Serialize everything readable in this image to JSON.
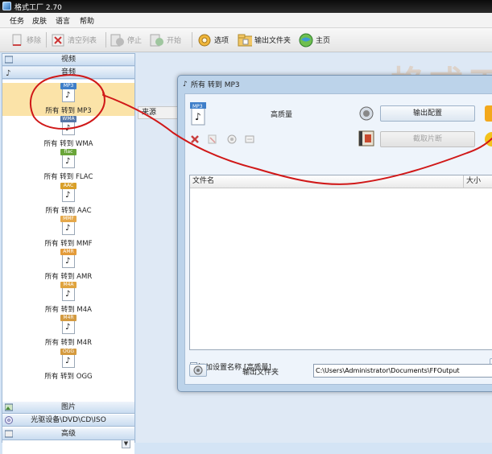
{
  "app": {
    "title": "格式工厂 2.70"
  },
  "menu": [
    "任务",
    "皮肤",
    "语言",
    "帮助"
  ],
  "toolbar": {
    "remove": "移除",
    "clear_list": "清空列表",
    "stop": "停止",
    "start": "开始",
    "options": "选项",
    "output_folder": "输出文件夹",
    "home": "主页"
  },
  "sidebar": {
    "categories_top": [
      {
        "label": "视频",
        "icon": "video-icon"
      },
      {
        "label": "音频",
        "icon": "audio-icon"
      }
    ],
    "conversions": [
      {
        "label": "所有 转到 MP3",
        "fmt": "MP3",
        "color": "#3f7fc9",
        "selected": true
      },
      {
        "label": "所有 转到 WMA",
        "fmt": "WMA",
        "color": "#5577a8"
      },
      {
        "label": "所有 转到 FLAC",
        "fmt": "flac",
        "color": "#6aa53a"
      },
      {
        "label": "所有 转到 AAC",
        "fmt": "AAC",
        "color": "#d9a02a"
      },
      {
        "label": "所有 转到 MMF",
        "fmt": "MMF",
        "color": "#e5a84a"
      },
      {
        "label": "所有 转到 AMR",
        "fmt": "AMR",
        "color": "#e39b3a"
      },
      {
        "label": "所有 转到 M4A",
        "fmt": "M4A",
        "color": "#e0a43f"
      },
      {
        "label": "所有 转到 M4R",
        "fmt": "M4R",
        "color": "#d39a40"
      },
      {
        "label": "所有 转到 OGG",
        "fmt": "OGG",
        "color": "#d49a3f"
      }
    ],
    "categories_bottom": [
      {
        "label": "图片",
        "icon": "picture-icon"
      },
      {
        "label": "光驱设备\\DVD\\CD\\ISO",
        "icon": "disc-icon"
      },
      {
        "label": "高级",
        "icon": "advanced-icon"
      }
    ],
    "scroll_down_glyph": "▼"
  },
  "main": {
    "logo_text": "格式工",
    "column_source": "来源"
  },
  "dialog": {
    "title": "所有 转到 MP3",
    "quality": "高质量",
    "output_config": "输出配置",
    "get_clip": "截取片断",
    "columns": [
      "文件名",
      "大小"
    ],
    "add_name_label": "添加设置名称 [高质量]",
    "add_name_checked": false,
    "output_folder_label": "输出文件夹",
    "output_path": "C:\\Users\\Administrator\\Documents\\FFOutput"
  },
  "colors": {
    "annotation": "#d01818",
    "selection_bg": "#fbe3a8"
  }
}
